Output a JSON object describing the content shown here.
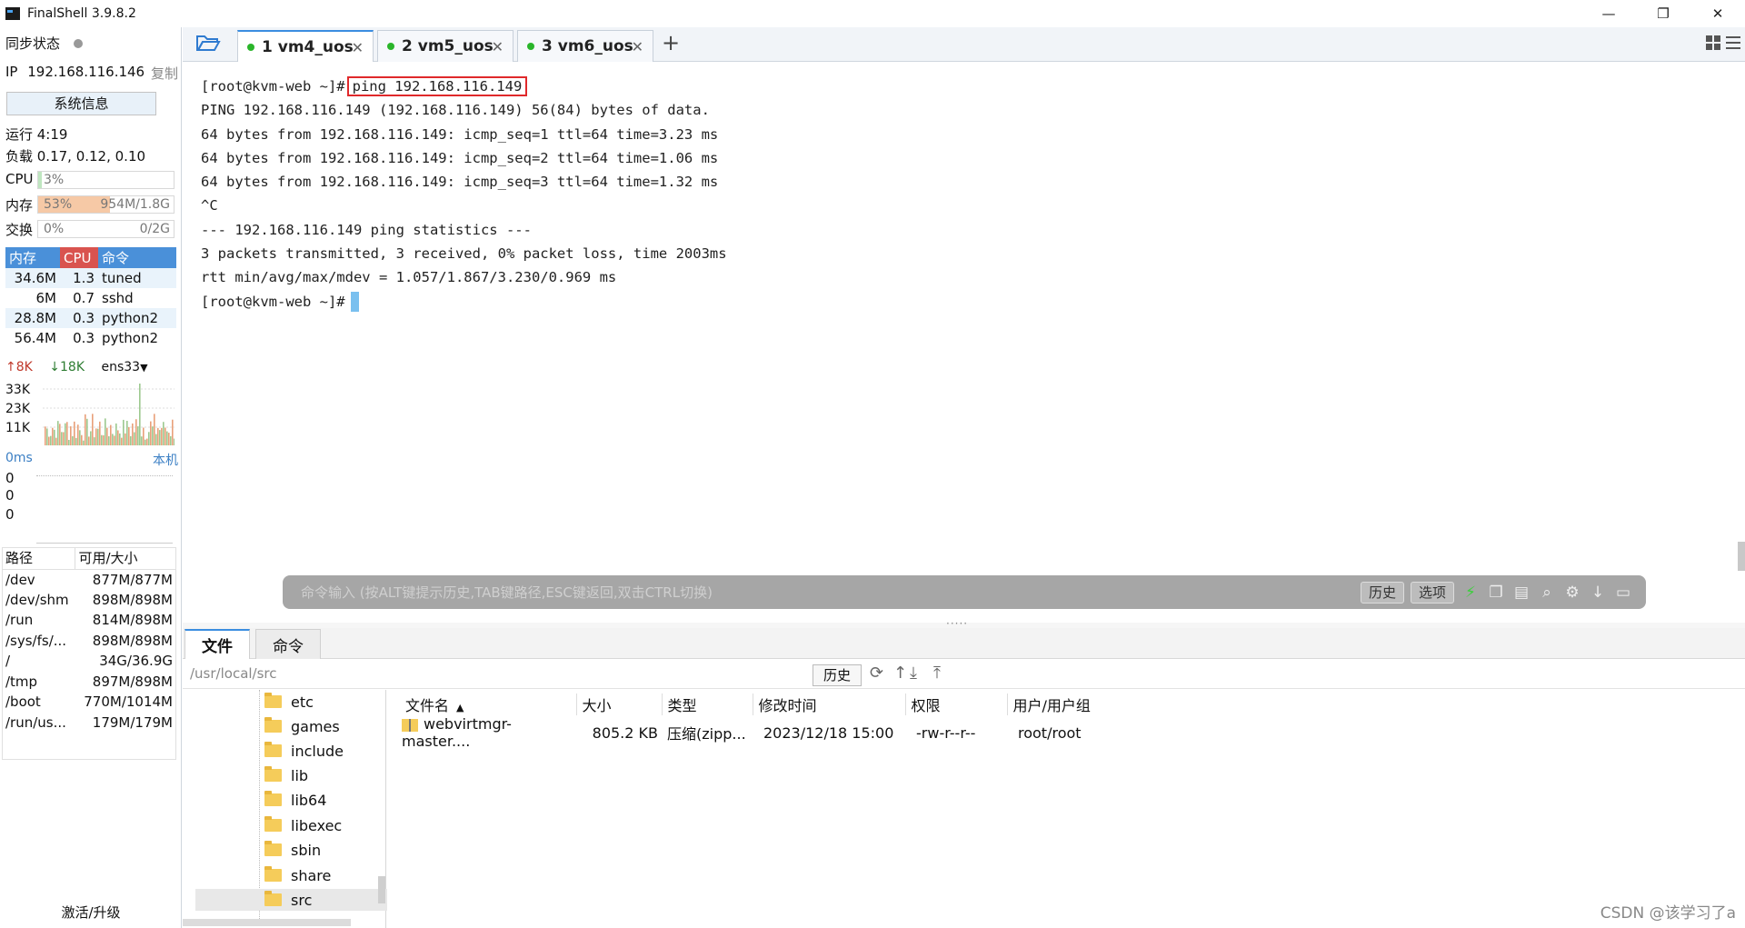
{
  "app": {
    "title": "FinalShell 3.9.8.2"
  },
  "window_controls": {
    "minimize": "—",
    "restore": "❐",
    "close": "✕"
  },
  "sidebar": {
    "sync_label": "同步状态",
    "ip_label": "IP",
    "ip_value": "192.168.116.146",
    "copy_label": "复制",
    "sysinfo_button": "系统信息",
    "uptime": "运行 4:19",
    "load": "负载 0.17, 0.12, 0.10",
    "cpu": {
      "label": "CPU",
      "percent": "3%",
      "level": 0.03
    },
    "mem": {
      "label": "内存",
      "percent": "53%",
      "capacity": "954M/1.8G",
      "level": 0.53
    },
    "swap": {
      "label": "交换",
      "percent": "0%",
      "capacity": "0/2G",
      "level": 0
    },
    "process_headers": [
      "内存",
      "CPU",
      "命令"
    ],
    "processes": [
      {
        "mem": "34.6M",
        "cpu": "1.3",
        "cmd": "tuned"
      },
      {
        "mem": "6M",
        "cpu": "0.7",
        "cmd": "sshd"
      },
      {
        "mem": "28.8M",
        "cpu": "0.3",
        "cmd": "python2"
      },
      {
        "mem": "56.4M",
        "cpu": "0.3",
        "cmd": "python2"
      }
    ],
    "net": {
      "up": "8K",
      "down": "18K",
      "iface": "ens33",
      "y_ticks": [
        "33K",
        "23K",
        "11K"
      ]
    },
    "ping": {
      "latency": "0ms",
      "target": "本机",
      "values": [
        "0",
        "0",
        "0"
      ]
    },
    "disk_headers": [
      "路径",
      "可用/大小"
    ],
    "disks": [
      {
        "path": "/dev",
        "size": "877M/877M"
      },
      {
        "path": "/dev/shm",
        "size": "898M/898M"
      },
      {
        "path": "/run",
        "size": "814M/898M"
      },
      {
        "path": "/sys/fs/...",
        "size": "898M/898M"
      },
      {
        "path": "/",
        "size": "34G/36.9G"
      },
      {
        "path": "/tmp",
        "size": "897M/898M"
      },
      {
        "path": "/boot",
        "size": "770M/1014M"
      },
      {
        "path": "/run/us...",
        "size": "179M/179M"
      }
    ],
    "activate": "激活/升级"
  },
  "tabs": [
    {
      "label": "1 vm4_uos",
      "active": true
    },
    {
      "label": "2 vm5_uos",
      "active": false
    },
    {
      "label": "3 vm6_uos",
      "active": false
    }
  ],
  "terminal": {
    "prompt": "[root@kvm-web ~]#",
    "command": "ping 192.168.116.149",
    "output": [
      "PING 192.168.116.149 (192.168.116.149) 56(84) bytes of data.",
      "64 bytes from 192.168.116.149: icmp_seq=1 ttl=64 time=3.23 ms",
      "64 bytes from 192.168.116.149: icmp_seq=2 ttl=64 time=1.06 ms",
      "64 bytes from 192.168.116.149: icmp_seq=3 ttl=64 time=1.32 ms",
      "^C",
      "--- 192.168.116.149 ping statistics ---",
      "3 packets transmitted, 3 received, 0% packet loss, time 2003ms",
      "rtt min/avg/max/mdev = 1.057/1.867/3.230/0.969 ms"
    ],
    "final_prompt": "[root@kvm-web ~]#"
  },
  "cmdbar": {
    "placeholder": "命令输入 (按ALT键提示历史,TAB键路径,ESC键返回,双击CTRL切换)",
    "history": "历史",
    "options": "选项"
  },
  "bottom": {
    "tabs": [
      "文件",
      "命令"
    ],
    "path": "/usr/local/src",
    "history": "历史",
    "tree": [
      "etc",
      "games",
      "include",
      "lib",
      "lib64",
      "libexec",
      "sbin",
      "share",
      "src"
    ],
    "file_headers": [
      "文件名",
      "大小",
      "类型",
      "修改时间",
      "权限",
      "用户/用户组"
    ],
    "files": [
      {
        "name": "webvirtmgr-master....",
        "size": "805.2 KB",
        "type": "压缩(zipp...",
        "mtime": "2023/12/18 15:00",
        "perm": "-rw-r--r--",
        "owner": "root/root"
      }
    ]
  },
  "watermark": "CSDN @该学习了a",
  "colors": {
    "accent": "#3b8de0",
    "mem_fill": "#f6c9a6",
    "cpu_header": "#d9534f",
    "table_header": "#4a90d9",
    "highlight_box": "#e0292b"
  }
}
